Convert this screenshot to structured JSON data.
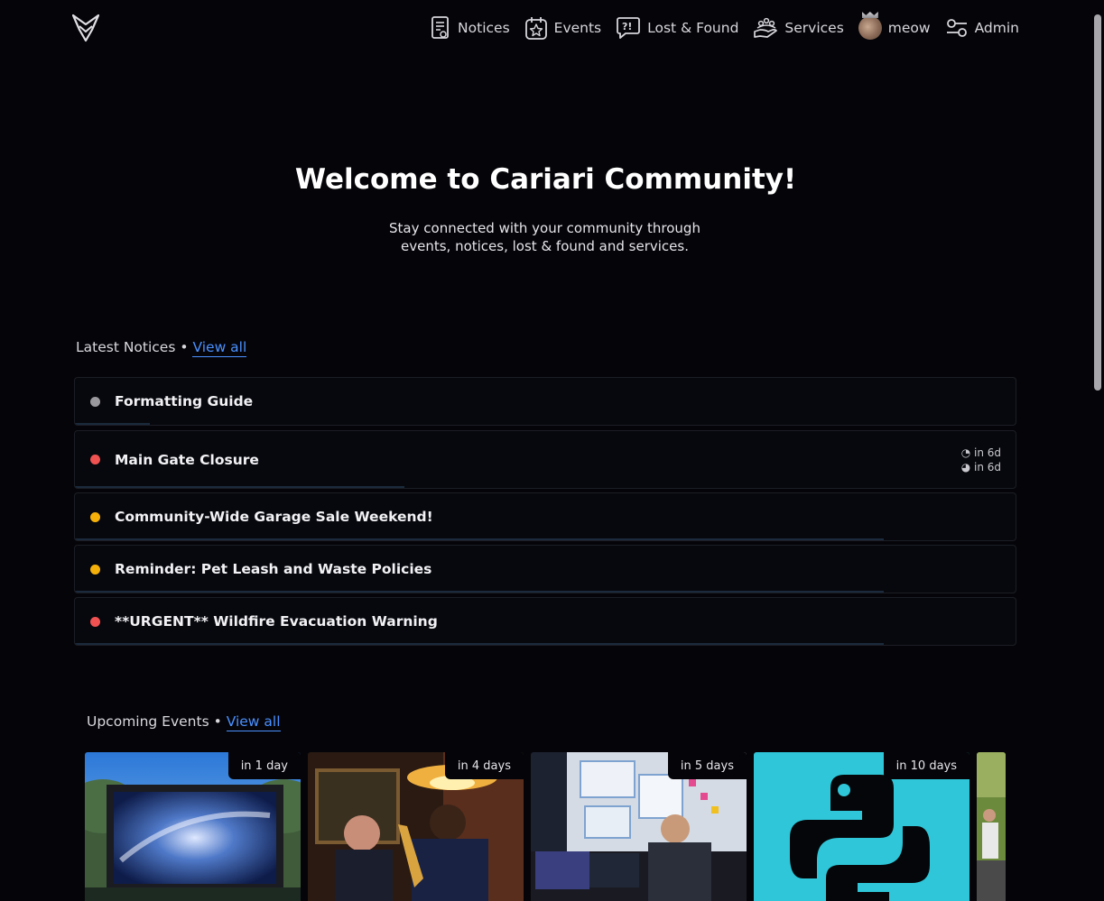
{
  "nav": {
    "items": [
      {
        "label": "Notices",
        "icon": "notice-board-icon"
      },
      {
        "label": "Events",
        "icon": "calendar-star-icon"
      },
      {
        "label": "Lost & Found",
        "icon": "question-bubble-icon"
      },
      {
        "label": "Services",
        "icon": "hand-service-icon"
      },
      {
        "label": "meow",
        "icon": "user-avatar"
      },
      {
        "label": "Admin",
        "icon": "sliders-icon"
      }
    ]
  },
  "hero": {
    "title": "Welcome to Cariari Community!",
    "subtitle": "Stay connected with your community through events, notices, lost & found and services."
  },
  "notices_section": {
    "title": "Latest Notices",
    "separator": "•",
    "view_all": "View all",
    "items": [
      {
        "title": "Formatting Guide",
        "status_color": "#9a9a9e",
        "progress": 0.08
      },
      {
        "title": "Main Gate Closure",
        "status_color": "#f05252",
        "progress": 0.35,
        "meta_line1": "◔ in 6d",
        "meta_line2": "◕ in 6d"
      },
      {
        "title": "Community-Wide Garage Sale Weekend!",
        "status_color": "#f5b10a",
        "progress": 0.86
      },
      {
        "title": "Reminder: Pet Leash and Waste Policies",
        "status_color": "#f5b10a",
        "progress": 0.86
      },
      {
        "title": "**URGENT** Wildfire Evacuation Warning",
        "status_color": "#f05252",
        "progress": 0.86
      }
    ]
  },
  "events_section": {
    "title": "Upcoming Events",
    "separator": "•",
    "view_all": "View all",
    "items": [
      {
        "badge": "in 1 day",
        "image": "outdoor-movie-screen-image"
      },
      {
        "badge": "in 4 days",
        "image": "jazz-saxophone-image"
      },
      {
        "badge": "in 5 days",
        "image": "developer-desk-image"
      },
      {
        "badge": "in 10 days",
        "image": "python-logo-image"
      },
      {
        "badge": "",
        "image": "runners-race-image"
      }
    ]
  },
  "colors": {
    "background": "#050509",
    "link": "#4a90ff",
    "status_gray": "#9a9a9e",
    "status_red": "#f05252",
    "status_yellow": "#f5b10a"
  }
}
